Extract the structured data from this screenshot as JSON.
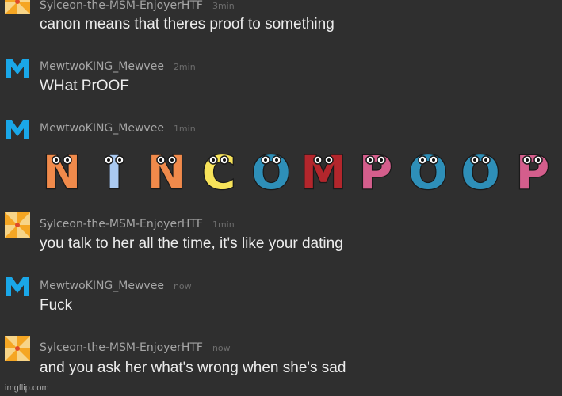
{
  "messages": [
    {
      "user": "Sylceon-the-MSM-EnjoyerHTF",
      "time": "3min",
      "text": "canon means that theres proof to something",
      "avatar": "pinwheel-avatar"
    },
    {
      "user": "MewtwoKING_Mewvee",
      "time": "2min",
      "text": "WHat PrOOF",
      "avatar": "m-avatar"
    },
    {
      "user": "MewtwoKING_Mewvee",
      "time": "1min",
      "text": "",
      "avatar": "m-avatar"
    },
    {
      "user": "Sylceon-the-MSM-EnjoyerHTF",
      "time": "1min",
      "text": "you talk to her all the time, it's like your dating",
      "avatar": "pinwheel-avatar"
    },
    {
      "user": "MewtwoKING_Mewvee",
      "time": "now",
      "text": "Fuck",
      "avatar": "m-avatar"
    },
    {
      "user": "Sylceon-the-MSM-EnjoyerHTF",
      "time": "now",
      "text": "and you ask her what's wrong when she's sad",
      "avatar": "pinwheel-avatar"
    }
  ],
  "letters": [
    {
      "char": "N",
      "color": "#f08a4b"
    },
    {
      "char": "I",
      "color": "#a9c8ef"
    },
    {
      "char": "N",
      "color": "#f08a4b"
    },
    {
      "char": "C",
      "color": "#f7e35a"
    },
    {
      "char": "O",
      "color": "#2e8fb8"
    },
    {
      "char": "M",
      "color": "#b3262c"
    },
    {
      "char": "P",
      "color": "#d45e8c"
    },
    {
      "char": "O",
      "color": "#2e8fb8"
    },
    {
      "char": "O",
      "color": "#2e8fb8"
    },
    {
      "char": "P",
      "color": "#d45e8c"
    }
  ],
  "watermark": "imgflip.com"
}
